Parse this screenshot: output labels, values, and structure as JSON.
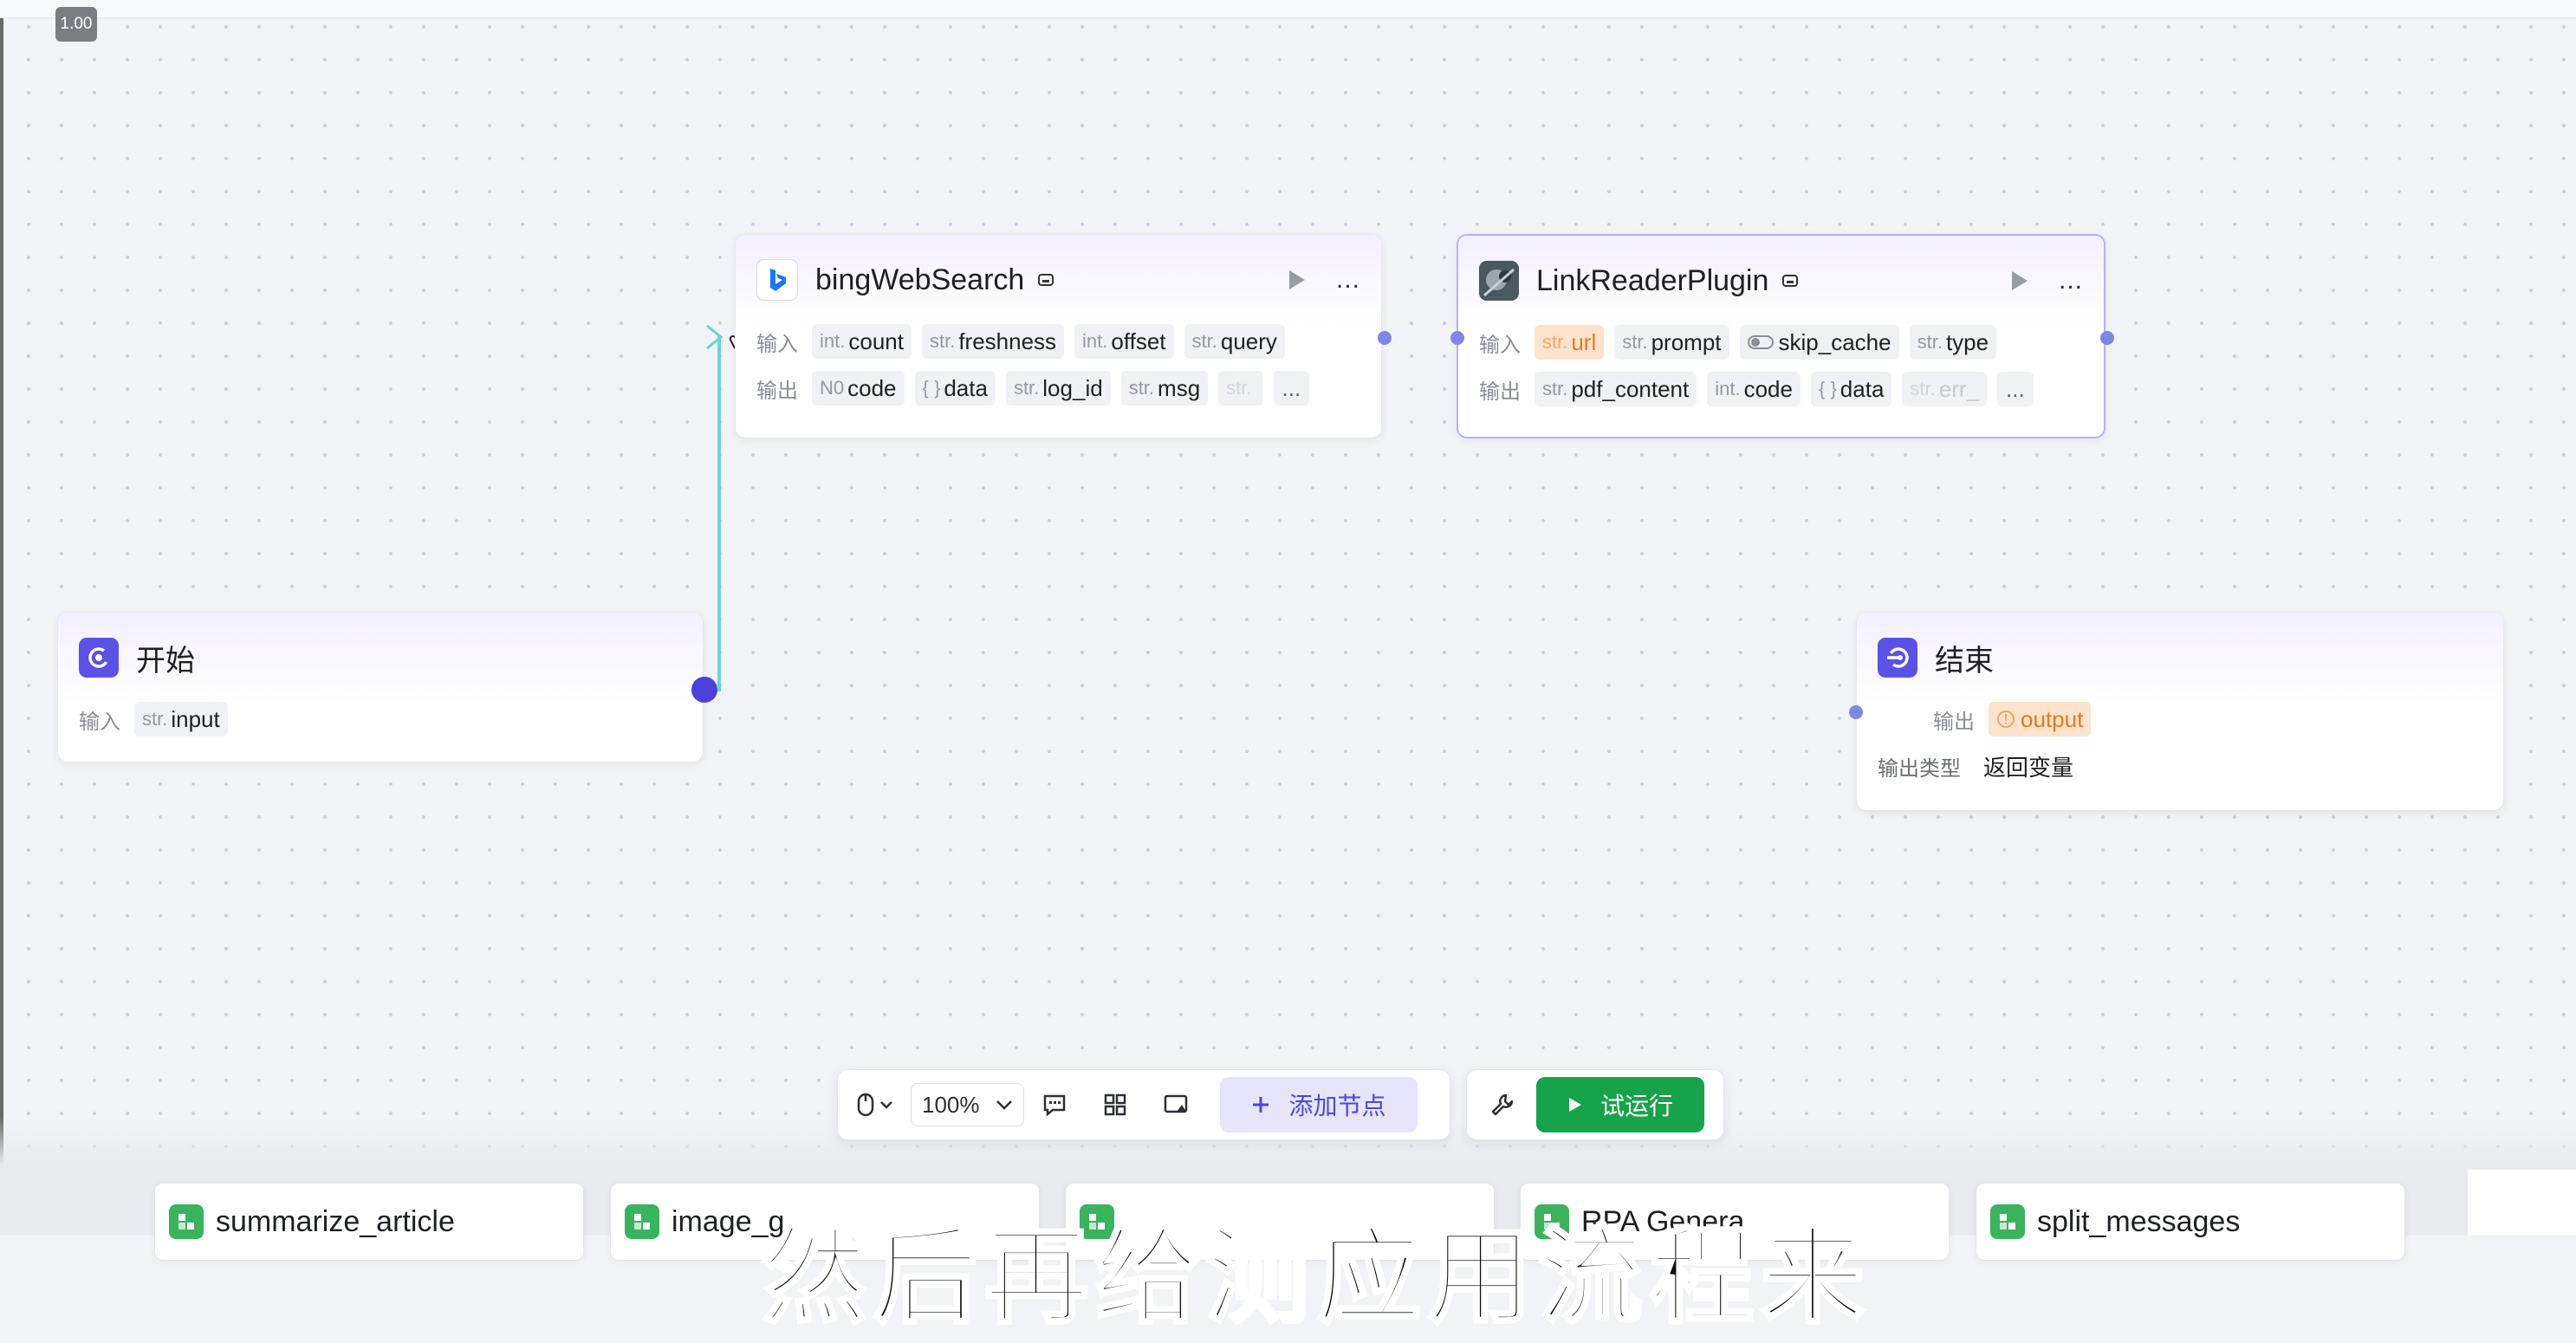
{
  "canvas": {
    "zoom_badge": "1.00"
  },
  "nodes": {
    "bing": {
      "title": "bingWebSearch",
      "input_label": "输入",
      "output_label": "输出",
      "inputs": [
        {
          "type": "int.",
          "name": "count"
        },
        {
          "type": "str.",
          "name": "freshness"
        },
        {
          "type": "int.",
          "name": "offset"
        },
        {
          "type": "str.",
          "name": "query"
        }
      ],
      "outputs": [
        {
          "type": "N0",
          "name": "code"
        },
        {
          "type": "{ }",
          "name": "data"
        },
        {
          "type": "str.",
          "name": "log_id"
        },
        {
          "type": "str.",
          "name": "msg"
        },
        {
          "type": "str.",
          "name": ""
        }
      ],
      "more": "..."
    },
    "linkreader": {
      "title": "LinkReaderPlugin",
      "input_label": "输入",
      "output_label": "输出",
      "inputs": [
        {
          "type": "str.",
          "name": "url"
        },
        {
          "type": "str.",
          "name": "prompt"
        },
        {
          "type": "",
          "name": "skip_cache"
        },
        {
          "type": "str.",
          "name": "type"
        }
      ],
      "outputs": [
        {
          "type": "str.",
          "name": "pdf_content"
        },
        {
          "type": "int.",
          "name": "code"
        },
        {
          "type": "{ }",
          "name": "data"
        },
        {
          "type": "str.",
          "name": "err_"
        }
      ],
      "more": "..."
    },
    "start": {
      "title": "开始",
      "input_label": "输入",
      "inputs": [
        {
          "type": "str.",
          "name": "input"
        }
      ]
    },
    "end": {
      "title": "结束",
      "output_label": "输出",
      "output_value": "output",
      "output_type_label": "输出类型",
      "output_type_value": "返回变量"
    }
  },
  "toolbar": {
    "zoom_value": "100%",
    "add_node_label": "添加节点",
    "run_label": "试运行"
  },
  "plugin_cards": [
    {
      "label": "summarize_article"
    },
    {
      "label": "image_g"
    },
    {
      "label": ""
    },
    {
      "label": "RPA Genera"
    },
    {
      "label": "split_messages"
    }
  ],
  "subtitle": "然后再给测应用流程来",
  "colors": {
    "accent": "#4e46dc",
    "run_green": "#17a34a",
    "edge": "#69d4d6",
    "port": "#7e86e6",
    "warn_bg": "#fde3cc"
  }
}
